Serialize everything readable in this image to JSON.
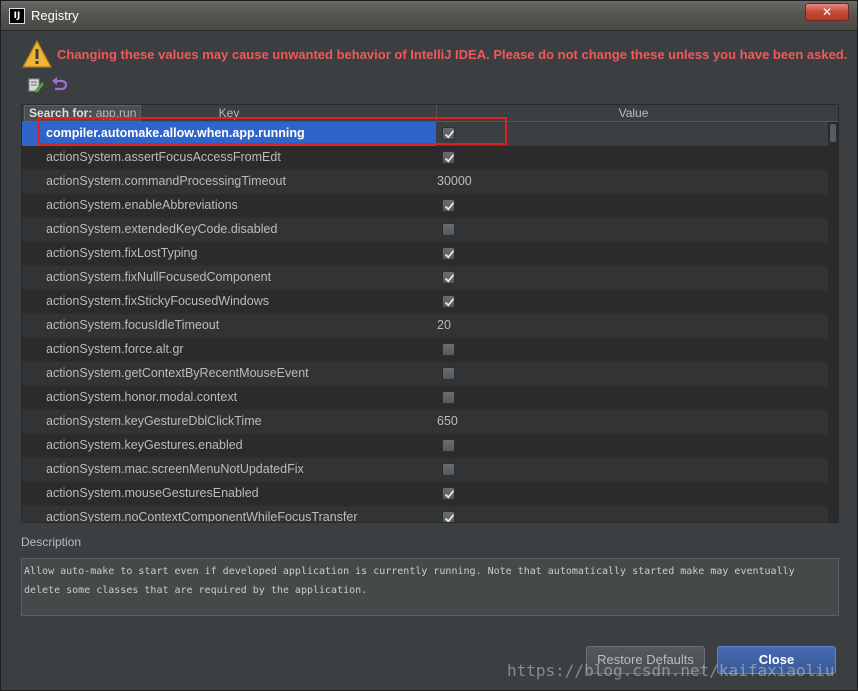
{
  "window": {
    "title": "Registry",
    "close_glyph": "✕"
  },
  "warning": {
    "text": "Changing these values may cause unwanted behavior of IntelliJ IDEA. Please do not change these unless you have been asked."
  },
  "table": {
    "speed_search_label": "Search for:",
    "speed_search_value": "app.run",
    "columns": {
      "key": "Key",
      "value": "Value"
    },
    "rows": [
      {
        "key": "compiler.automake.allow.when.app.running",
        "type": "checkbox",
        "checked": true,
        "selected": true
      },
      {
        "key": "actionSystem.assertFocusAccessFromEdt",
        "type": "checkbox",
        "checked": true
      },
      {
        "key": "actionSystem.commandProcessingTimeout",
        "type": "text",
        "value": "30000"
      },
      {
        "key": "actionSystem.enableAbbreviations",
        "type": "checkbox",
        "checked": true
      },
      {
        "key": "actionSystem.extendedKeyCode.disabled",
        "type": "checkbox",
        "checked": false
      },
      {
        "key": "actionSystem.fixLostTyping",
        "type": "checkbox",
        "checked": true
      },
      {
        "key": "actionSystem.fixNullFocusedComponent",
        "type": "checkbox",
        "checked": true
      },
      {
        "key": "actionSystem.fixStickyFocusedWindows",
        "type": "checkbox",
        "checked": true
      },
      {
        "key": "actionSystem.focusIdleTimeout",
        "type": "text",
        "value": "20"
      },
      {
        "key": "actionSystem.force.alt.gr",
        "type": "checkbox",
        "checked": false
      },
      {
        "key": "actionSystem.getContextByRecentMouseEvent",
        "type": "checkbox",
        "checked": false
      },
      {
        "key": "actionSystem.honor.modal.context",
        "type": "checkbox",
        "checked": false
      },
      {
        "key": "actionSystem.keyGestureDblClickTime",
        "type": "text",
        "value": "650"
      },
      {
        "key": "actionSystem.keyGestures.enabled",
        "type": "checkbox",
        "checked": false
      },
      {
        "key": "actionSystem.mac.screenMenuNotUpdatedFix",
        "type": "checkbox",
        "checked": false
      },
      {
        "key": "actionSystem.mouseGesturesEnabled",
        "type": "checkbox",
        "checked": true
      },
      {
        "key": "actionSystem.noContextComponentWhileFocusTransfer",
        "type": "checkbox",
        "checked": true
      }
    ]
  },
  "description": {
    "label": "Description",
    "text": "Allow auto-make to start even if developed application is currently running. Note that automatically started make may eventually delete some classes that are required by the application."
  },
  "buttons": {
    "restore_defaults": "Restore Defaults",
    "close": "Close"
  },
  "watermark": "https://blog.csdn.net/kaifaxiaoliu",
  "icons": {
    "app": "intellij-logo-icon",
    "warning": "warning-icon",
    "edit": "edit-icon",
    "revert": "revert-icon"
  },
  "colors": {
    "warning_text": "#ee5a5a",
    "selection": "#2f65ca",
    "highlight_box": "#e02020"
  }
}
